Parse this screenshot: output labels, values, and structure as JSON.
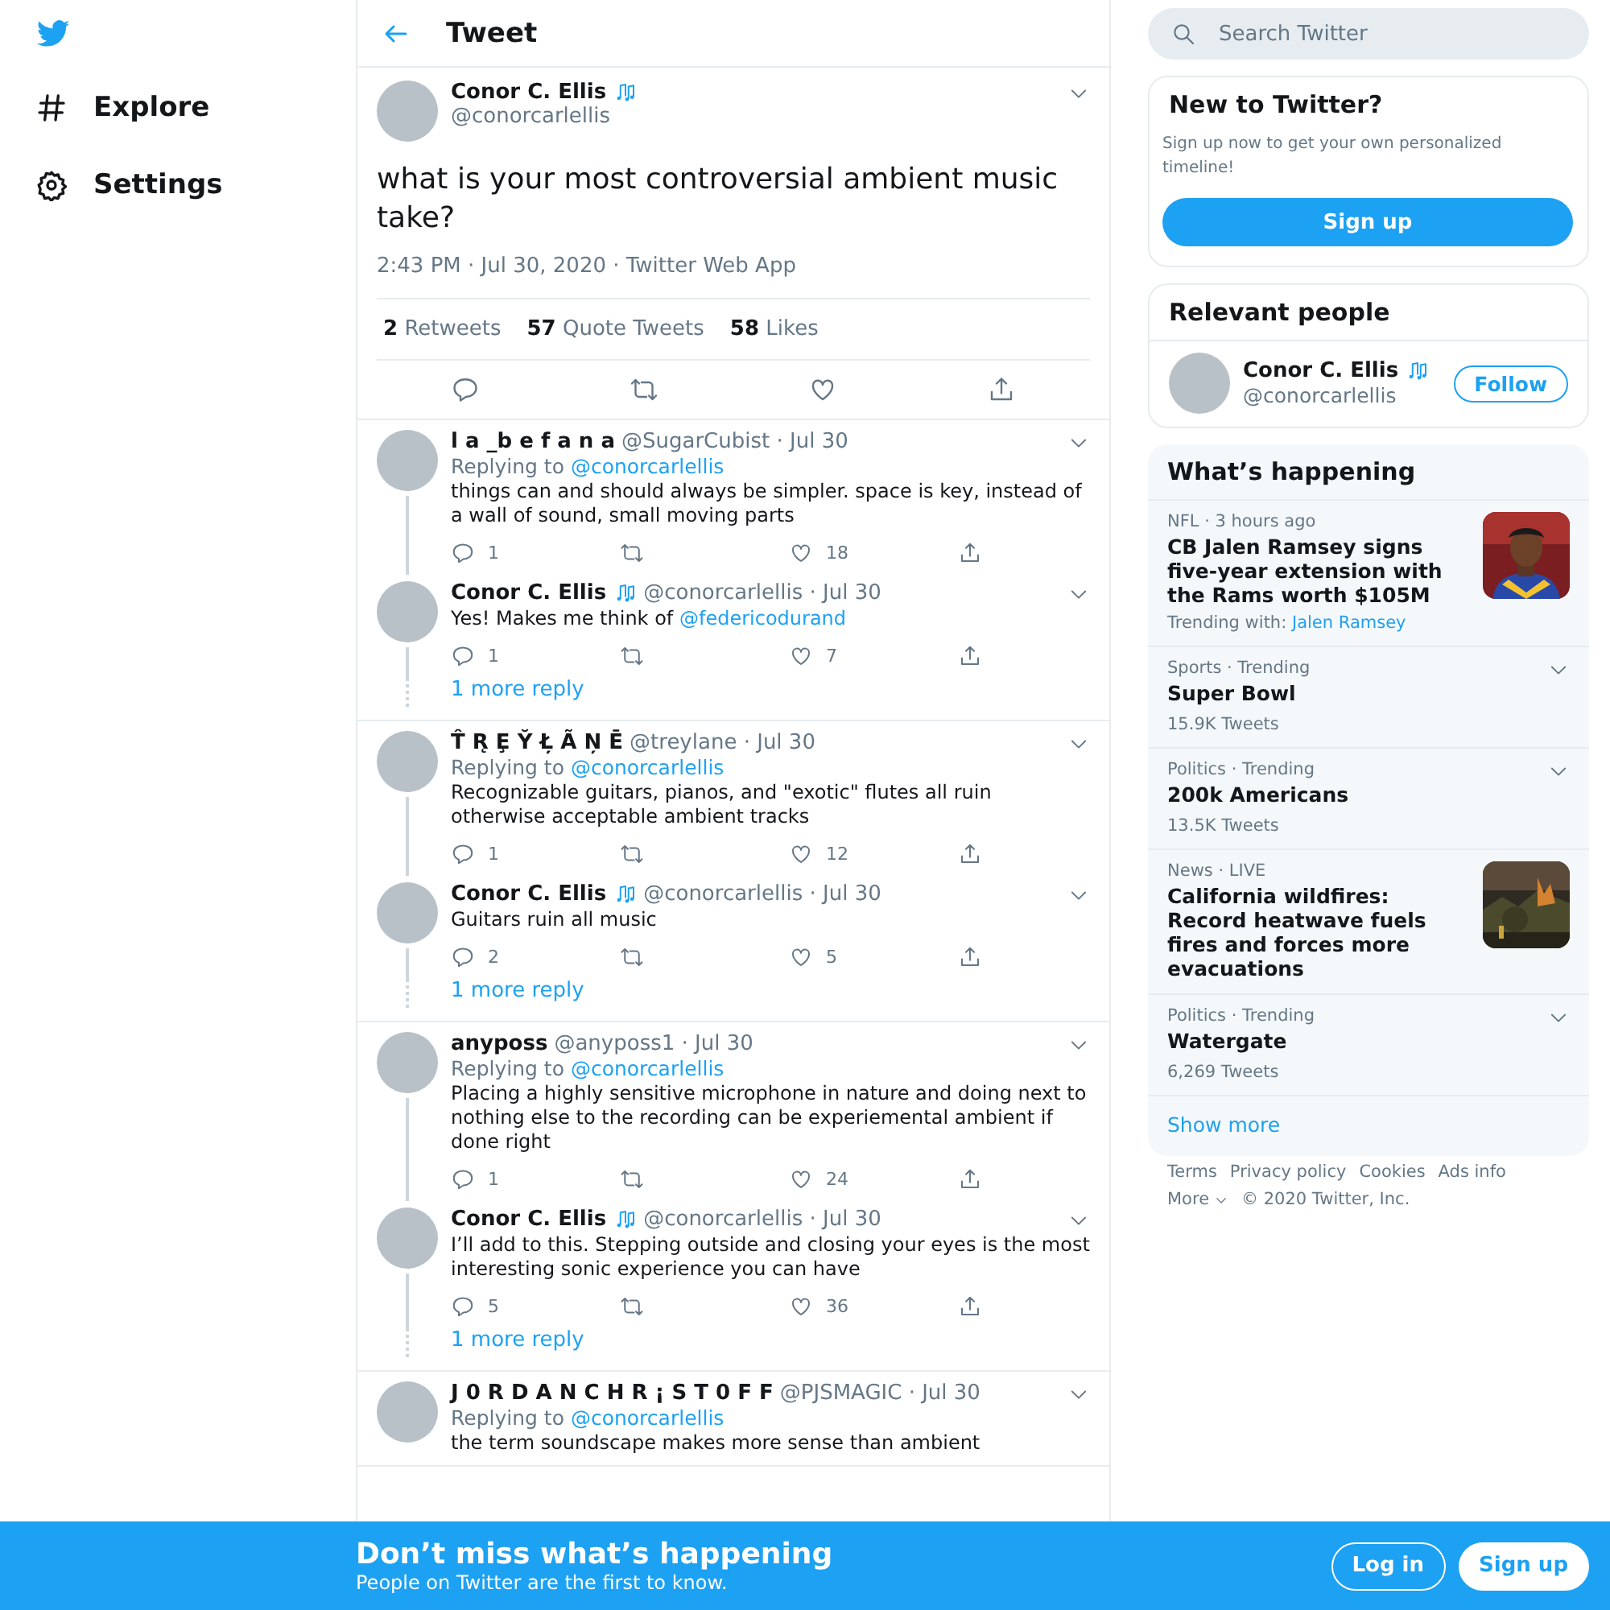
{
  "nav": [
    {
      "kind": "explore",
      "label": "Explore"
    },
    {
      "kind": "settings",
      "label": "Settings"
    }
  ],
  "header": {
    "title": "Tweet"
  },
  "main_tweet": {
    "name": "Conor C. Ellis",
    "verified_music": true,
    "handle": "@conorcarlellis",
    "text": "what is your most controversial ambient music take?",
    "meta": "2:43 PM · Jul 30, 2020 · Twitter Web App",
    "stats": [
      {
        "count": "2",
        "label": "Retweets"
      },
      {
        "count": "57",
        "label": "Quote Tweets"
      },
      {
        "count": "58",
        "label": "Likes"
      }
    ]
  },
  "threads": [
    {
      "tweets": [
        {
          "name": "l a _b e f a n a",
          "verified_music": false,
          "handle": "@SugarCubist",
          "date": "· Jul 30",
          "replying_label": "Replying to",
          "replying_to": "@conorcarlellis",
          "text": "things can and should always be simpler.  space is key, instead of a wall of sound, small moving parts",
          "replies": "1",
          "likes": "18"
        },
        {
          "name": "Conor C. Ellis",
          "verified_music": true,
          "handle": "@conorcarlellis",
          "date": "· Jul 30",
          "text": "Yes! Makes me think of",
          "mention": "@federicodurand",
          "replies": "1",
          "likes": "7"
        }
      ],
      "more": "1 more reply"
    },
    {
      "tweets": [
        {
          "name": "T̂ R̨ Ȩ Y̆ Ł̦ Ã N̦ Ē",
          "verified_music": false,
          "handle": "@treylane",
          "date": "· Jul 30",
          "replying_label": "Replying to",
          "replying_to": "@conorcarlellis",
          "text": "Recognizable guitars, pianos, and \"exotic\" flutes all ruin otherwise acceptable ambient tracks",
          "replies": "1",
          "likes": "12"
        },
        {
          "name": "Conor C. Ellis",
          "verified_music": true,
          "handle": "@conorcarlellis",
          "date": "· Jul 30",
          "text": "Guitars ruin all music",
          "replies": "2",
          "likes": "5"
        }
      ],
      "more": "1 more reply"
    },
    {
      "tweets": [
        {
          "name": "anyposs",
          "verified_music": false,
          "handle": "@anyposs1",
          "date": "· Jul 30",
          "replying_label": "Replying to",
          "replying_to": "@conorcarlellis",
          "text": "Placing a highly sensitive microphone in nature and doing next to nothing else to the recording can be experiemental ambient if done right",
          "replies": "1",
          "likes": "24"
        },
        {
          "name": "Conor C. Ellis",
          "verified_music": true,
          "handle": "@conorcarlellis",
          "date": "· Jul 30",
          "text": "I’ll add to this. Stepping outside and closing your eyes is the most interesting sonic experience you can have",
          "replies": "5",
          "likes": "36"
        }
      ],
      "more": "1 more reply"
    },
    {
      "tweets": [
        {
          "name": "J 0 R D A N C H R ¡ S T 0 F F",
          "verified_music": false,
          "handle": "@PJSMAGIC",
          "date": "· Jul 30",
          "replying_label": "Replying to",
          "replying_to": "@conorcarlellis",
          "text": "the term soundscape makes more sense than ambient"
        }
      ]
    }
  ],
  "search": {
    "placeholder": "Search Twitter"
  },
  "new_to_twitter": {
    "title": "New to Twitter?",
    "text": "Sign up now to get your own personalized timeline!",
    "button": "Sign up"
  },
  "relevant_people": {
    "title": "Relevant people",
    "person": {
      "name": "Conor C. Ellis",
      "verified_music": true,
      "handle": "@conorcarlellis",
      "button": "Follow"
    }
  },
  "whats_happening": {
    "title": "What’s happening",
    "trends": [
      {
        "kind": "story",
        "meta": "NFL · 3 hours ago",
        "title": "CB Jalen Ramsey signs five-year extension with the Rams worth $105M",
        "trending_label": "Trending with:",
        "trending_link": "Jalen Ramsey"
      },
      {
        "kind": "trend",
        "meta": "Sports · Trending",
        "title": "Super Bowl",
        "count": "15.9K Tweets"
      },
      {
        "kind": "trend",
        "meta": "Politics · Trending",
        "title": "200k Americans",
        "count": "13.5K Tweets"
      },
      {
        "kind": "story",
        "meta": "News · LIVE",
        "title": "California wildfires: Record heatwave fuels fires and forces more evacuations"
      },
      {
        "kind": "trend",
        "meta": "Politics · Trending",
        "title": "Watergate",
        "count": "6,269 Tweets"
      }
    ],
    "show_more": "Show more"
  },
  "footer": {
    "links": [
      "Terms",
      "Privacy policy",
      "Cookies",
      "Ads info"
    ],
    "more": "More",
    "copyright": "© 2020 Twitter, Inc."
  },
  "banner": {
    "title": "Don’t miss what’s happening",
    "subtitle": "People on Twitter are the first to know.",
    "login": "Log in",
    "signup": "Sign up"
  }
}
